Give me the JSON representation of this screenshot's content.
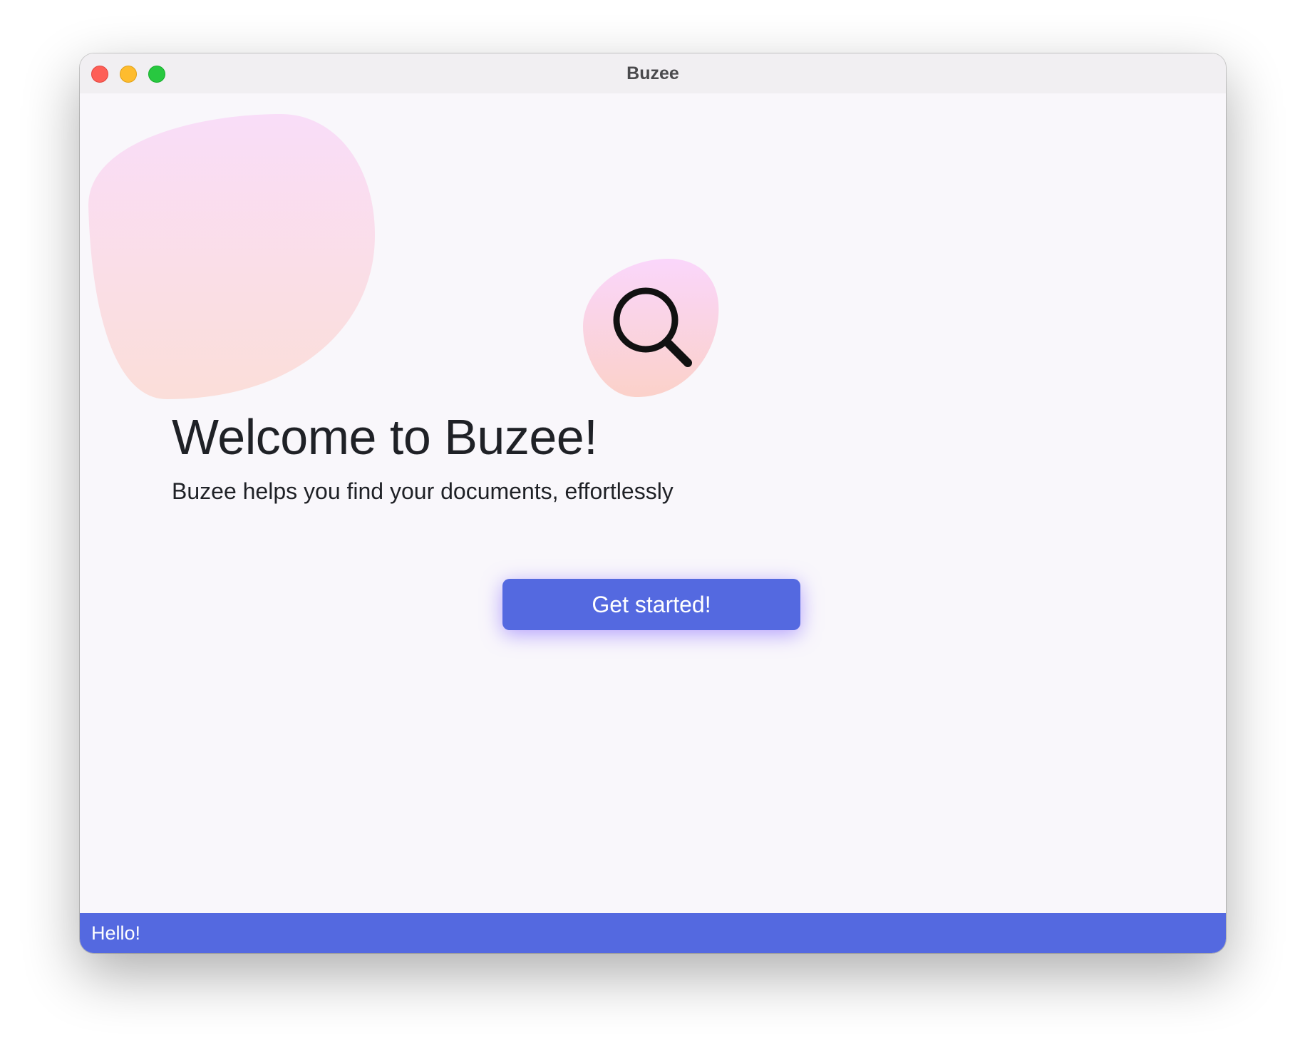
{
  "window": {
    "title": "Buzee"
  },
  "welcome": {
    "heading": "Welcome to Buzee!",
    "subheading": "Buzee helps you find your documents, effortlessly",
    "logo_icon": "magnifying-glass-icon"
  },
  "actions": {
    "get_started_label": "Get started!"
  },
  "statusbar": {
    "text": "Hello!"
  },
  "colors": {
    "accent": "#5469e0",
    "blob_top": "#f9dcf8",
    "blob_bottom": "#fbd6d2",
    "background": "#f9f7fb",
    "text": "#1f2126"
  }
}
